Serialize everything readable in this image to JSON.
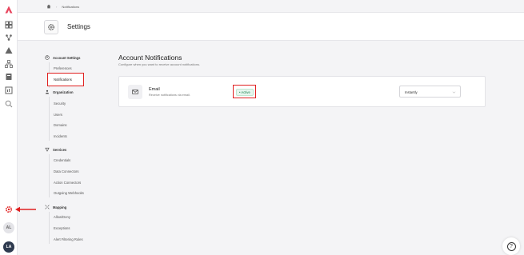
{
  "breadcrumb": {
    "current": "Notifications"
  },
  "header": {
    "title": "Settings"
  },
  "nav": {
    "account_settings": "Account Settings",
    "preferences": "Preferences",
    "notifications": "Notifications",
    "organization": "Organization",
    "security": "Security",
    "users": "Users",
    "domains": "Domains",
    "incidents": "Incidents",
    "services": "Services",
    "credentials": "Credentials",
    "data_connectors": "Data Connectors",
    "action_connectors": "Action Connectors",
    "outgoing_webhooks": "Outgoing Webhooks",
    "mapping": "Mapping",
    "allow_deny": "Allow/Deny",
    "exceptions": "Exceptions",
    "alert_filtering_rules": "Alert Filtering Rules"
  },
  "main": {
    "title": "Account Notifications",
    "subtitle": "Configure when you want to receive account notifications."
  },
  "email_card": {
    "title": "Email",
    "description": "Receive notifications via email.",
    "status": "Active",
    "frequency": "Instantly"
  },
  "rail": {
    "avatar_1": "AL",
    "avatar_2": "LA"
  },
  "help": {
    "label": "?"
  },
  "colors": {
    "accent": "#e02020",
    "active_green": "#1a7f4a",
    "logo": "#e8475f"
  }
}
